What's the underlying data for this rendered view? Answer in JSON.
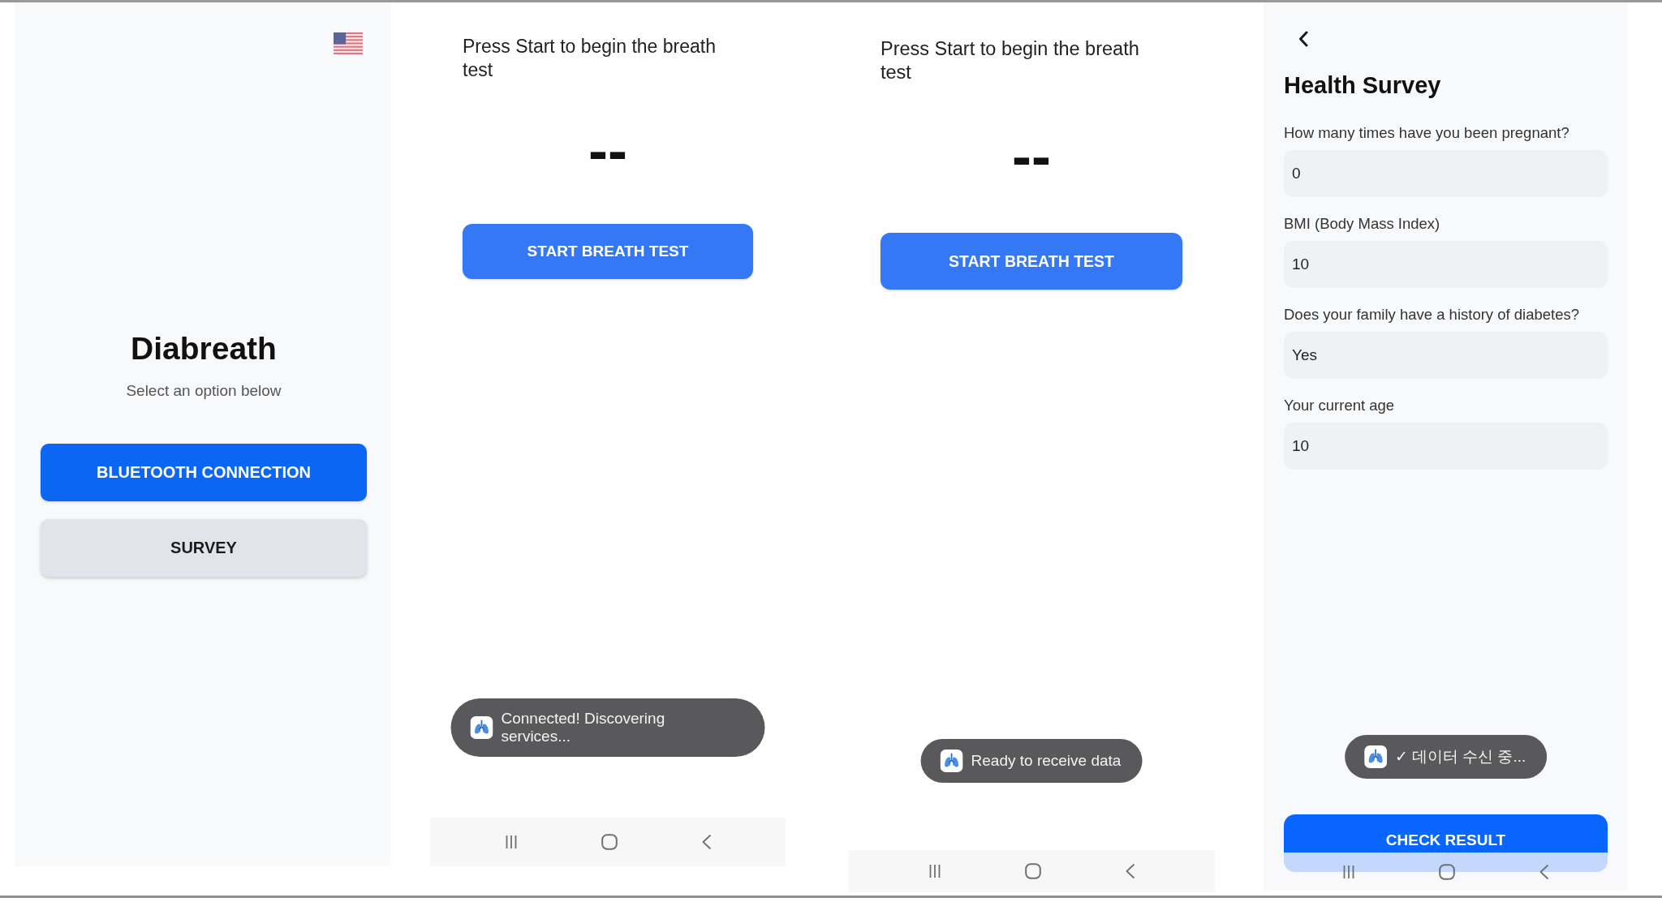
{
  "screens": [
    {
      "kind": "home",
      "title": "Diabreath",
      "subtitle": "Select an option below",
      "buttons": [
        {
          "kind": "primary",
          "label": "BLUETOOTH CONNECTION"
        },
        {
          "kind": "secondary",
          "label": "SURVEY"
        }
      ]
    },
    {
      "kind": "breath_test",
      "prompt": "Press Start to begin the breath test",
      "reading": "--",
      "button": "START BREATH TEST",
      "toast": "Connected! Discovering services..."
    },
    {
      "kind": "breath_test",
      "prompt": "Press Start to begin the breath test",
      "reading": "--",
      "button": "START BREATH TEST",
      "toast": "Ready to receive data"
    },
    {
      "kind": "survey",
      "title": "Health Survey",
      "fields": [
        {
          "label": "How many times have you been pregnant?",
          "value": "0"
        },
        {
          "label": "BMI (Body Mass Index)",
          "value": "10"
        },
        {
          "label": "Does your family have a history of diabetes?",
          "value": "Yes"
        },
        {
          "label": "Your current age",
          "value": "10"
        }
      ],
      "toast": "✓ 데이터 수신 중...",
      "button": "CHECK RESULT"
    }
  ]
}
